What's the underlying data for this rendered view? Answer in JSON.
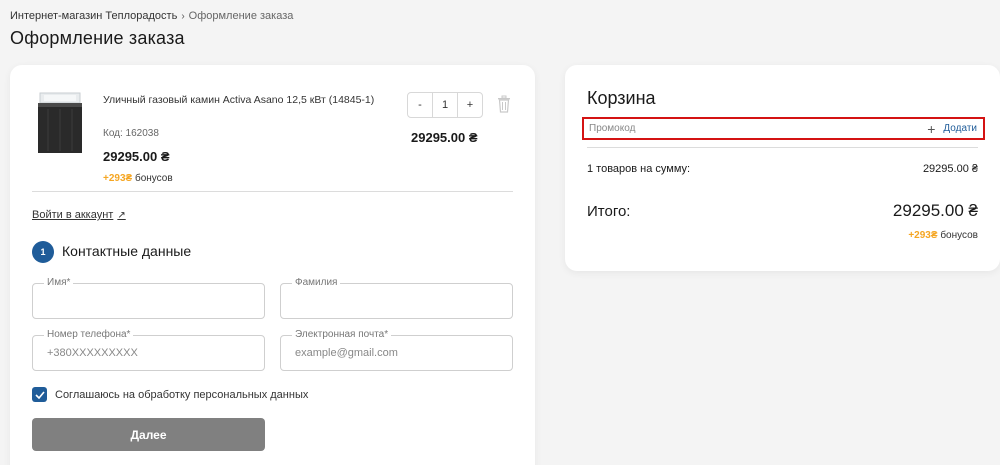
{
  "breadcrumb": {
    "home": "Интернет-магазин Теплорадость",
    "current": "Оформление заказа"
  },
  "page_title": "Оформление заказа",
  "product": {
    "name": "Уличный газовый камин Activa Asano 12,5 кВт (14845-1)",
    "code": "Код: 162038",
    "price": "29295.00 ₴",
    "bonus_amount": "+293₴",
    "bonus_label": "бонусов",
    "quantity": "1",
    "minus": "-",
    "plus": "+",
    "item_total": "29295.00 ₴"
  },
  "login_link": "Войти в аккаунт",
  "contact": {
    "step": "1",
    "title": "Контактные данные",
    "name_label": "Имя*",
    "surname_label": "Фамилия",
    "phone_label": "Номер телефона*",
    "phone_placeholder": "+380XXXXXXXXX",
    "email_label": "Электронная почта*",
    "email_placeholder": "example@gmail.com",
    "consent": "Соглашаюсь на обработку персональных данных",
    "next": "Далее"
  },
  "cart": {
    "title": "Корзина",
    "promo_label": "Промокод",
    "promo_add": "Додати",
    "sum_label": "1 товаров на сумму:",
    "sum_value": "29295.00 ₴",
    "total_label": "Итого:",
    "total_value": "29295.00 ₴",
    "bonus_amount": "+293₴",
    "bonus_label": "бонусов"
  },
  "colors": {
    "accent": "#1f5c99",
    "bonus": "#f5a623",
    "highlight": "#d41313",
    "button": "#808080"
  }
}
